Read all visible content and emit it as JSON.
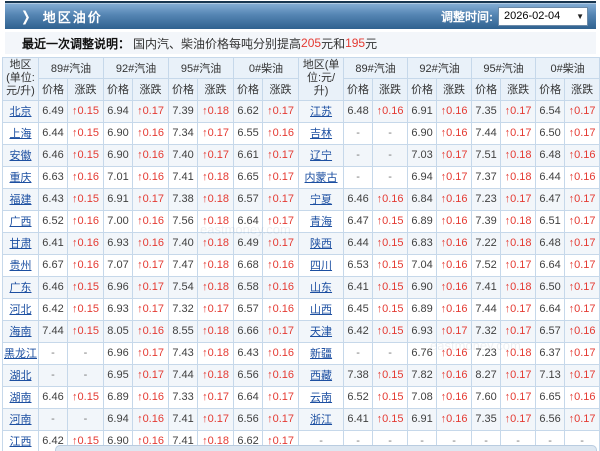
{
  "header": {
    "arrow_icon": "❯",
    "title": "地区油价",
    "time_label": "调整时间:",
    "time_value": "2026-02-04"
  },
  "notice": {
    "label": "最近一次调整说明：",
    "segments": {
      "before": "国内汽、柴油价格每吨分别提高",
      "amount1": "205",
      "middle": "元和",
      "amount2": "195",
      "after": "元"
    }
  },
  "watermark": "eastmoney.com",
  "colors": {
    "accent_red": "#e43a32",
    "link_blue": "#1c4fa1",
    "bar_blue_top": "#87b0d6",
    "bar_blue_bottom": "#2f618f",
    "header_cell_bg": "#e9f1f9",
    "alt_row_bg": "#f2f6fa"
  },
  "table": {
    "region_header": "地区(单位:元/升)",
    "group_headers": [
      "89#汽油",
      "92#汽油",
      "95#汽油",
      "0#柴油"
    ],
    "sub_headers": [
      "价格",
      "涨跌"
    ],
    "rows_left": [
      {
        "region": "北京",
        "values": [
          "6.49",
          "↑0.15",
          "6.94",
          "↑0.17",
          "7.39",
          "↑0.18",
          "6.62",
          "↑0.17"
        ]
      },
      {
        "region": "上海",
        "values": [
          "6.44",
          "↑0.15",
          "6.90",
          "↑0.16",
          "7.34",
          "↑0.17",
          "6.55",
          "↑0.16"
        ]
      },
      {
        "region": "安徽",
        "values": [
          "6.46",
          "↑0.15",
          "6.90",
          "↑0.16",
          "7.40",
          "↑0.17",
          "6.61",
          "↑0.17"
        ]
      },
      {
        "region": "重庆",
        "values": [
          "6.63",
          "↑0.16",
          "7.01",
          "↑0.16",
          "7.41",
          "↑0.18",
          "6.65",
          "↑0.17"
        ]
      },
      {
        "region": "福建",
        "values": [
          "6.43",
          "↑0.15",
          "6.91",
          "↑0.17",
          "7.38",
          "↑0.18",
          "6.57",
          "↑0.17"
        ]
      },
      {
        "region": "广西",
        "values": [
          "6.52",
          "↑0.16",
          "7.00",
          "↑0.16",
          "7.56",
          "↑0.18",
          "6.64",
          "↑0.17"
        ]
      },
      {
        "region": "甘肃",
        "values": [
          "6.41",
          "↑0.16",
          "6.93",
          "↑0.16",
          "7.40",
          "↑0.18",
          "6.49",
          "↑0.17"
        ]
      },
      {
        "region": "贵州",
        "values": [
          "6.67",
          "↑0.16",
          "7.07",
          "↑0.17",
          "7.47",
          "↑0.18",
          "6.68",
          "↑0.16"
        ]
      },
      {
        "region": "广东",
        "values": [
          "6.46",
          "↑0.15",
          "6.96",
          "↑0.17",
          "7.54",
          "↑0.18",
          "6.58",
          "↑0.16"
        ]
      },
      {
        "region": "河北",
        "values": [
          "6.42",
          "↑0.15",
          "6.93",
          "↑0.17",
          "7.32",
          "↑0.17",
          "6.57",
          "↑0.16"
        ]
      },
      {
        "region": "海南",
        "values": [
          "7.44",
          "↑0.15",
          "8.05",
          "↑0.16",
          "8.55",
          "↑0.18",
          "6.66",
          "↑0.17"
        ]
      },
      {
        "region": "黑龙江",
        "values": [
          "-",
          "-",
          "6.96",
          "↑0.17",
          "7.43",
          "↑0.18",
          "6.43",
          "↑0.16"
        ]
      },
      {
        "region": "湖北",
        "values": [
          "-",
          "-",
          "6.95",
          "↑0.17",
          "7.44",
          "↑0.18",
          "6.56",
          "↑0.16"
        ]
      },
      {
        "region": "湖南",
        "values": [
          "6.46",
          "↑0.15",
          "6.89",
          "↑0.16",
          "7.33",
          "↑0.17",
          "6.64",
          "↑0.17"
        ]
      },
      {
        "region": "河南",
        "values": [
          "-",
          "-",
          "6.94",
          "↑0.16",
          "7.41",
          "↑0.17",
          "6.56",
          "↑0.17"
        ]
      },
      {
        "region": "江西",
        "values": [
          "6.42",
          "↑0.15",
          "6.90",
          "↑0.16",
          "7.41",
          "↑0.18",
          "6.62",
          "↑0.17"
        ]
      }
    ],
    "rows_right": [
      {
        "region": "江苏",
        "values": [
          "6.48",
          "↑0.16",
          "6.91",
          "↑0.16",
          "7.35",
          "↑0.17",
          "6.54",
          "↑0.17"
        ]
      },
      {
        "region": "吉林",
        "values": [
          "-",
          "-",
          "6.90",
          "↑0.16",
          "7.44",
          "↑0.17",
          "6.50",
          "↑0.17"
        ]
      },
      {
        "region": "辽宁",
        "values": [
          "-",
          "-",
          "7.03",
          "↑0.17",
          "7.51",
          "↑0.18",
          "6.48",
          "↑0.16"
        ]
      },
      {
        "region": "内蒙古",
        "values": [
          "-",
          "-",
          "6.94",
          "↑0.17",
          "7.37",
          "↑0.18",
          "6.44",
          "↑0.16"
        ]
      },
      {
        "region": "宁夏",
        "values": [
          "6.46",
          "↑0.16",
          "6.84",
          "↑0.16",
          "7.23",
          "↑0.17",
          "6.47",
          "↑0.17"
        ]
      },
      {
        "region": "青海",
        "values": [
          "6.47",
          "↑0.15",
          "6.89",
          "↑0.16",
          "7.39",
          "↑0.18",
          "6.51",
          "↑0.17"
        ]
      },
      {
        "region": "陕西",
        "values": [
          "6.44",
          "↑0.15",
          "6.83",
          "↑0.16",
          "7.22",
          "↑0.18",
          "6.48",
          "↑0.17"
        ]
      },
      {
        "region": "四川",
        "values": [
          "6.53",
          "↑0.15",
          "7.04",
          "↑0.16",
          "7.52",
          "↑0.17",
          "6.64",
          "↑0.17"
        ]
      },
      {
        "region": "山东",
        "values": [
          "6.41",
          "↑0.15",
          "6.90",
          "↑0.16",
          "7.41",
          "↑0.18",
          "6.50",
          "↑0.17"
        ]
      },
      {
        "region": "山西",
        "values": [
          "6.45",
          "↑0.15",
          "6.89",
          "↑0.16",
          "7.44",
          "↑0.17",
          "6.64",
          "↑0.17"
        ]
      },
      {
        "region": "天津",
        "values": [
          "6.42",
          "↑0.15",
          "6.93",
          "↑0.17",
          "7.32",
          "↑0.17",
          "6.57",
          "↑0.16"
        ]
      },
      {
        "region": "新疆",
        "values": [
          "-",
          "-",
          "6.76",
          "↑0.16",
          "7.23",
          "↑0.18",
          "6.37",
          "↑0.17"
        ]
      },
      {
        "region": "西藏",
        "values": [
          "7.38",
          "↑0.15",
          "7.82",
          "↑0.16",
          "8.27",
          "↑0.17",
          "7.13",
          "↑0.17"
        ]
      },
      {
        "region": "云南",
        "values": [
          "6.52",
          "↑0.15",
          "7.08",
          "↑0.16",
          "7.60",
          "↑0.17",
          "6.65",
          "↑0.16"
        ]
      },
      {
        "region": "浙江",
        "values": [
          "6.41",
          "↑0.15",
          "6.91",
          "↑0.16",
          "7.35",
          "↑0.17",
          "6.56",
          "↑0.17"
        ]
      },
      {
        "region": "-",
        "values": [
          "-",
          "-",
          "-",
          "-",
          "-",
          "-",
          "-",
          "-"
        ]
      }
    ]
  }
}
